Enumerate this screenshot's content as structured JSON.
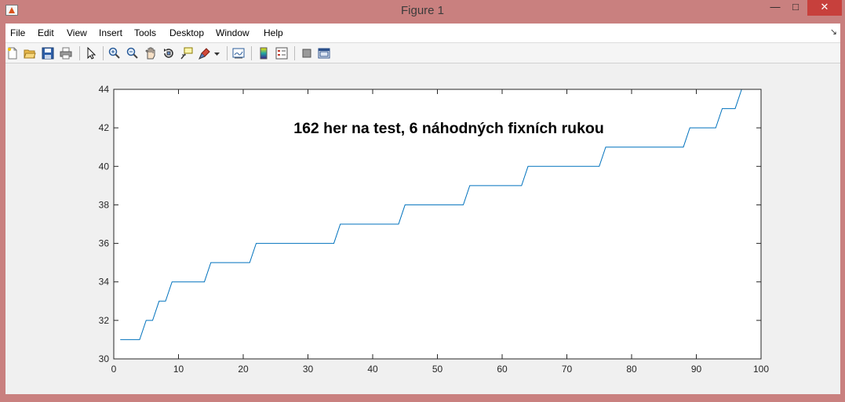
{
  "window": {
    "title": "Figure 1",
    "minimize_glyph": "—",
    "maximize_glyph": "□",
    "close_glyph": "✕"
  },
  "menu": {
    "items": [
      "File",
      "Edit",
      "View",
      "Insert",
      "Tools",
      "Desktop",
      "Window",
      "Help"
    ],
    "more_glyph": "↘"
  },
  "toolbar": {
    "icons": [
      "new-figure-icon",
      "open-file-icon",
      "save-icon",
      "print-icon",
      "edit-plot-arrow-icon",
      "zoom-in-icon",
      "zoom-out-icon",
      "pan-hand-icon",
      "rotate-3d-icon",
      "data-cursor-icon",
      "brush-icon",
      "brush-dropdown-icon",
      "link-plot-icon",
      "insert-colorbar-icon",
      "insert-legend-icon",
      "hide-plot-tools-icon",
      "show-plot-tools-icon"
    ]
  },
  "chart_data": {
    "type": "line",
    "title": "162 her na test, 6 náhodných fixních rukou",
    "xlabel": "",
    "ylabel": "",
    "xlim": [
      0,
      100
    ],
    "ylim": [
      30,
      44
    ],
    "xticks": [
      0,
      10,
      20,
      30,
      40,
      50,
      60,
      70,
      80,
      90,
      100
    ],
    "yticks": [
      30,
      32,
      34,
      36,
      38,
      40,
      42,
      44
    ],
    "grid": false,
    "line_color": "#0072bd",
    "series": [
      {
        "x": [
          1,
          4,
          5,
          6,
          7,
          8,
          9,
          14,
          15,
          21,
          22,
          34,
          35,
          44,
          45,
          54,
          55,
          63,
          64,
          75,
          76,
          88,
          89,
          93,
          94,
          96,
          97,
          100
        ],
        "y": [
          31,
          31,
          32,
          32,
          33,
          33,
          34,
          34,
          35,
          35,
          36,
          36,
          37,
          37,
          38,
          38,
          39,
          39,
          40,
          40,
          41,
          41,
          42,
          42,
          43,
          43,
          44,
          44
        ]
      }
    ]
  }
}
